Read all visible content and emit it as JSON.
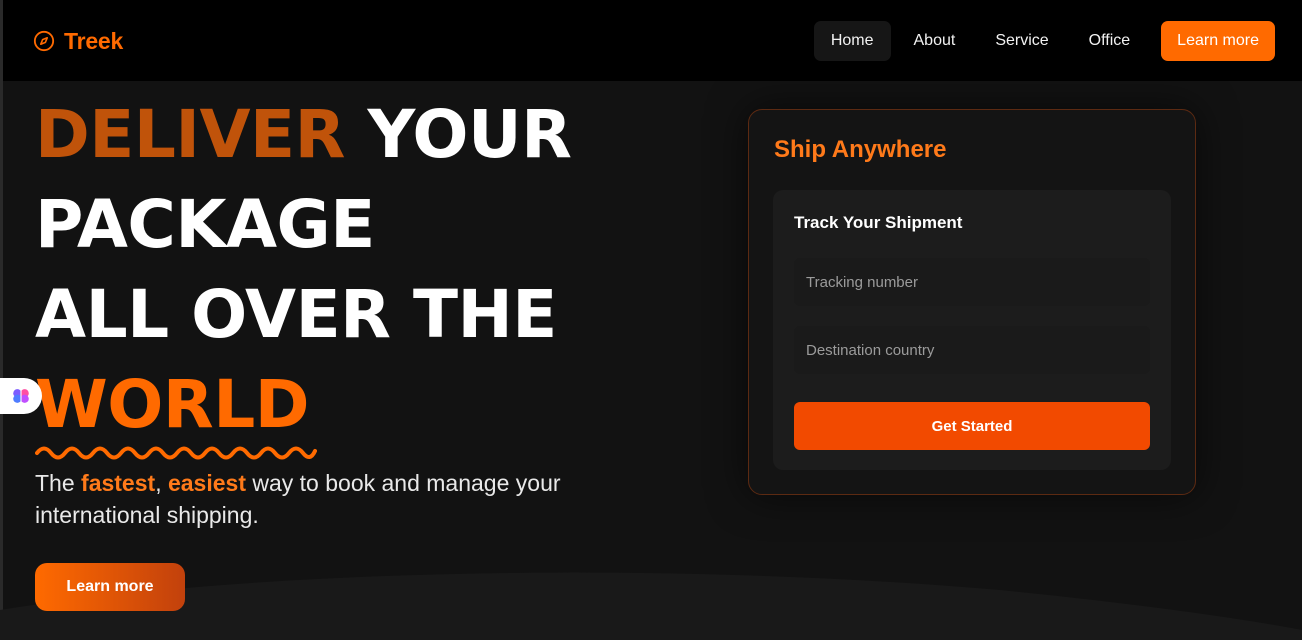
{
  "brand": {
    "name": "Treek",
    "icon": "compass-icon",
    "color": "#ff6a00"
  },
  "nav": {
    "items": [
      {
        "label": "Home",
        "active": true
      },
      {
        "label": "About"
      },
      {
        "label": "Service"
      },
      {
        "label": "Office"
      }
    ],
    "cta_label": "Learn more"
  },
  "hero": {
    "line1_accent": "DELIVER",
    "line1_rest": "YOUR",
    "line2": "PACKAGE",
    "line3": "ALL OVER THE",
    "line4": "WORLD",
    "subtitle": {
      "part1": "The ",
      "hl1": "fastest",
      "part2": ", ",
      "hl2": "easiest",
      "part3": " way to book and manage your international shipping."
    },
    "cta_label": "Learn more"
  },
  "card": {
    "title": "Ship Anywhere",
    "form_title": "Track Your Shipment",
    "tracking_placeholder": "Tracking number",
    "country_placeholder": "Destination country",
    "submit_label": "Get Started"
  },
  "colors": {
    "accent": "#ff6a00",
    "accent_dark": "#c0530a",
    "button": "#f24a00",
    "background": "#121212"
  }
}
